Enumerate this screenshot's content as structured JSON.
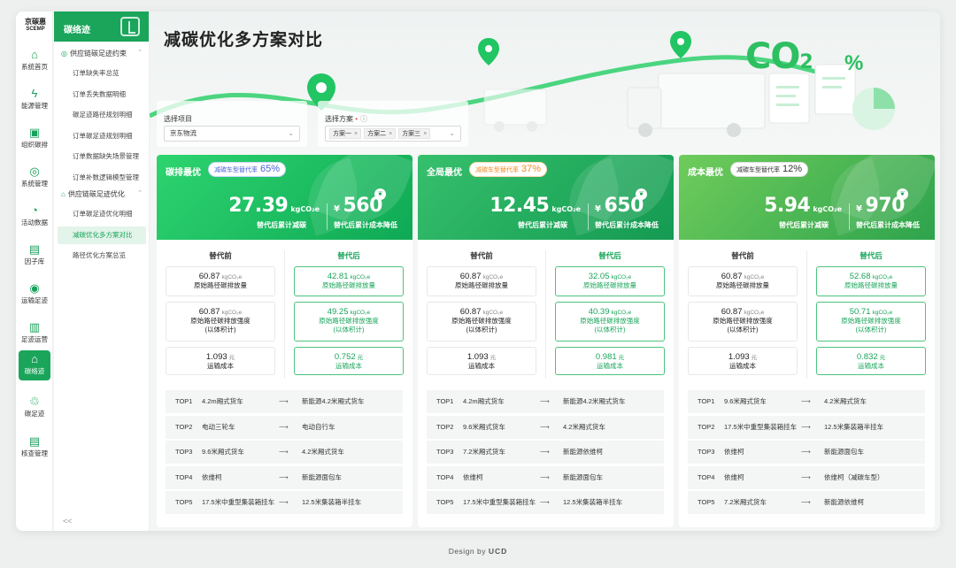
{
  "brand": {
    "name": "京碳惠",
    "en": "SCEMP"
  },
  "rail": [
    {
      "icon": "home-icon",
      "glyph": "⌂",
      "label": "系统首页"
    },
    {
      "icon": "energy-icon",
      "glyph": "ϟ",
      "label": "能源管理"
    },
    {
      "icon": "org-icon",
      "glyph": "▣",
      "label": "组织碳排"
    },
    {
      "icon": "target-icon",
      "glyph": "◎",
      "label": "系统管理"
    },
    {
      "icon": "activity-icon",
      "glyph": "◔",
      "label": "活动数据"
    },
    {
      "icon": "factor-icon",
      "glyph": "▤",
      "label": "因子库"
    },
    {
      "icon": "location-icon",
      "glyph": "◉",
      "label": "运输足迹"
    },
    {
      "icon": "ops-icon",
      "glyph": "▥",
      "label": "足迹运营"
    },
    {
      "icon": "carbon-track-icon",
      "glyph": "⌂",
      "label": "碳络迹"
    },
    {
      "icon": "lca-icon",
      "glyph": "♲",
      "label": "碳足迹"
    },
    {
      "icon": "verify-icon",
      "glyph": "▤",
      "label": "核查管理"
    }
  ],
  "submenu": {
    "title": "碳络迹",
    "group1": "供应链碳足迹约束",
    "items1": [
      "订单缺失率总览",
      "订单丢失数据明细",
      "碳足迹路径规划明细",
      "订单碳足迹规划明细",
      "订单数据缺失场景管理",
      "订单补数逻辑模型管理"
    ],
    "group2": "供应链碳足迹优化",
    "items2": [
      "订单碳足迹优化明细",
      "减碳优化多方案对比",
      "路径优化方案总览"
    ],
    "collapse": "<<"
  },
  "page": {
    "title": "减碳优化多方案对比"
  },
  "filters": {
    "project_label": "选择项目",
    "project_value": "京东物流",
    "plan_label": "选择方案",
    "plan_required": "•",
    "plan_tags": [
      "方案一",
      "方案二",
      "方案三"
    ]
  },
  "hero": {
    "co2": "CO",
    "co2_sub": "2",
    "percent": "%"
  },
  "cards": [
    {
      "title": "碳排最优",
      "badge_label": "减碳车型替代率",
      "badge_value": "65%",
      "reduce_value": "27.39",
      "reduce_unit": "kgCO₂e",
      "reduce_label": "替代后累计减碳",
      "cost_currency": "¥",
      "cost_value": "560",
      "cost_label": "替代后累计成本降低",
      "before_head": "替代前",
      "after_head": "替代后",
      "rows": [
        {
          "before": "60.87",
          "before_unit": "kgCO₂e",
          "before_desc": "原始路径碳排放量",
          "after": "42.81",
          "after_unit": "kgCO₂e",
          "after_desc": "原始路径碳排放量"
        },
        {
          "before": "60.87",
          "before_unit": "kgCO₂e",
          "before_desc": "原始路径碳排放强度",
          "before_desc2": "(以体积计)",
          "after": "49.25",
          "after_unit": "kgCO₂e",
          "after_desc": "原始路径碳排放强度",
          "after_desc2": "(以体积计)"
        },
        {
          "before": "1.093",
          "before_unit": "元",
          "before_desc": "运输成本",
          "after": "0.752",
          "after_unit": "元",
          "after_desc": "运输成本"
        }
      ],
      "routes": [
        {
          "rank": "TOP1",
          "from": "4.2m厢式货车",
          "arrow": "⟶",
          "to": "新能源4.2米厢式货车"
        },
        {
          "rank": "TOP2",
          "from": "电动三轮车",
          "arrow": "⟶",
          "to": "电动自行车"
        },
        {
          "rank": "TOP3",
          "from": "9.6米厢式货车",
          "arrow": "⟶",
          "to": "4.2米厢式货车"
        },
        {
          "rank": "TOP4",
          "from": "依维柯",
          "arrow": "⟶",
          "to": "新能源面包车"
        },
        {
          "rank": "TOP5",
          "from": "17.5米中重型集装箱挂车",
          "arrow": "⟶",
          "to": "12.5米集装箱半挂车"
        }
      ]
    },
    {
      "title": "全局最优",
      "badge_label": "减碳车型替代率",
      "badge_value": "37%",
      "reduce_value": "12.45",
      "reduce_unit": "kgCO₂e",
      "reduce_label": "替代后累计减碳",
      "cost_currency": "¥",
      "cost_value": "650",
      "cost_label": "替代后累计成本降低",
      "before_head": "替代前",
      "after_head": "替代后",
      "rows": [
        {
          "before": "60.87",
          "before_unit": "kgCO₂e",
          "before_desc": "原始路径碳排放量",
          "after": "32.05",
          "after_unit": "kgCO₂e",
          "after_desc": "原始路径碳排放量"
        },
        {
          "before": "60.87",
          "before_unit": "kgCO₂e",
          "before_desc": "原始路径碳排放强度",
          "before_desc2": "(以体积计)",
          "after": "40.39",
          "after_unit": "kgCO₂e",
          "after_desc": "原始路径碳排放强度",
          "after_desc2": "(以体积计)"
        },
        {
          "before": "1.093",
          "before_unit": "元",
          "before_desc": "运输成本",
          "after": "0.981",
          "after_unit": "元",
          "after_desc": "运输成本"
        }
      ],
      "routes": [
        {
          "rank": "TOP1",
          "from": "4.2m厢式货车",
          "arrow": "⟶",
          "to": "新能源4.2米厢式货车"
        },
        {
          "rank": "TOP2",
          "from": "9.6米厢式货车",
          "arrow": "⟶",
          "to": "4.2米厢式货车"
        },
        {
          "rank": "TOP3",
          "from": "7.2米厢式货车",
          "arrow": "⟶",
          "to": "新能源依维柯"
        },
        {
          "rank": "TOP4",
          "from": "依维柯",
          "arrow": "⟶",
          "to": "新能源面包车"
        },
        {
          "rank": "TOP5",
          "from": "17.5米中重型集装箱挂车",
          "arrow": "⟶",
          "to": "12.5米集装箱半挂车"
        }
      ]
    },
    {
      "title": "成本最优",
      "badge_label": "减碳车型替代率",
      "badge_value": "12%",
      "reduce_value": "5.94",
      "reduce_unit": "kgCO₂e",
      "reduce_label": "替代后累计减碳",
      "cost_currency": "¥",
      "cost_value": "970",
      "cost_label": "替代后累计成本降低",
      "before_head": "替代前",
      "after_head": "替代后",
      "rows": [
        {
          "before": "60.87",
          "before_unit": "kgCO₂e",
          "before_desc": "原始路径碳排放量",
          "after": "52.68",
          "after_unit": "kgCO₂e",
          "after_desc": "原始路径碳排放量"
        },
        {
          "before": "60.87",
          "before_unit": "kgCO₂e",
          "before_desc": "原始路径碳排放强度",
          "before_desc2": "(以体积计)",
          "after": "50.71",
          "after_unit": "kgCO₂e",
          "after_desc": "原始路径碳排放强度",
          "after_desc2": "(以体积计)"
        },
        {
          "before": "1.093",
          "before_unit": "元",
          "before_desc": "运输成本",
          "after": "0.832",
          "after_unit": "元",
          "after_desc": "运输成本"
        }
      ],
      "routes": [
        {
          "rank": "TOP1",
          "from": "9.6米厢式货车",
          "arrow": "⟶",
          "to": "4.2米厢式货车"
        },
        {
          "rank": "TOP2",
          "from": "17.5米中重型集装箱挂车",
          "arrow": "⟶",
          "to": "12.5米集装箱半挂车"
        },
        {
          "rank": "TOP3",
          "from": "依维柯",
          "arrow": "⟶",
          "to": "新能源面包车"
        },
        {
          "rank": "TOP4",
          "from": "依维柯",
          "arrow": "⟶",
          "to": "依维柯（减碳车型）"
        },
        {
          "rank": "TOP5",
          "from": "7.2米厢式货车",
          "arrow": "⟶",
          "to": "新能源依维柯"
        }
      ]
    }
  ],
  "footer": {
    "prefix": "Design by",
    "brand": "UCD"
  },
  "colors": {
    "primary": "#1aa55b",
    "accent_blue": "#4a63d8",
    "accent_orange": "#f08a24"
  }
}
